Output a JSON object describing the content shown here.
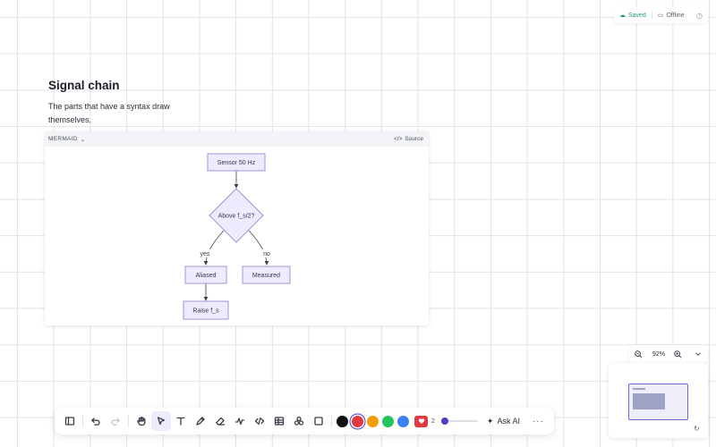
{
  "status": {
    "saved": "Saved",
    "offline": "Offline"
  },
  "doc": {
    "title": "Signal chain",
    "paragraph": "The parts that have a syntax draw themselves."
  },
  "mermaid": {
    "lang_label": "MERMAID",
    "source_label": "Source",
    "nodes": {
      "sensor": "Sensor 50 Hz",
      "decision": "Above f_s/2?",
      "aliased": "Aliased",
      "measured": "Measured",
      "raise": "Raise f_s"
    },
    "edges": {
      "yes": "yes",
      "no": "no"
    }
  },
  "zoom": {
    "level": "92%"
  },
  "toolbar": {
    "tools": [
      "sidebar-icon",
      "undo-icon",
      "redo-icon",
      "hand-icon",
      "select-icon",
      "text-icon",
      "pen-icon",
      "eraser-icon",
      "connector-icon",
      "code-icon",
      "table-icon",
      "shapes-icon",
      "rectangle-icon"
    ],
    "colors": [
      "#111111",
      "#e0383e",
      "#f59e0b",
      "#22c55e",
      "#3b82f6"
    ],
    "selected_color": "#e0383e",
    "lock_count": "2",
    "ask_ai": "Ask AI"
  }
}
